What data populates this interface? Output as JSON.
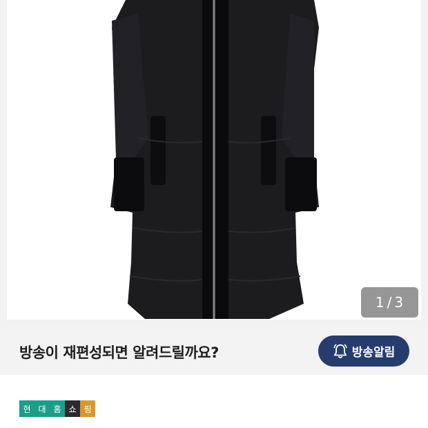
{
  "gallery": {
    "image_alt": "black long padded coat",
    "counter": {
      "current": "1",
      "separator": "/",
      "total": "3"
    }
  },
  "notify": {
    "prompt": "방송이 재편성되면 알려드릴까요?",
    "button_label": "방송알림",
    "button_icon": "bell-icon",
    "button_color": "#253c6d"
  },
  "brand": {
    "chars": [
      "현",
      "대",
      "홈",
      "쇼",
      "핑"
    ],
    "colors": {
      "primary": "#1a9e8a",
      "dark": "#2b2b2b",
      "accent": "#d59a2e"
    }
  }
}
